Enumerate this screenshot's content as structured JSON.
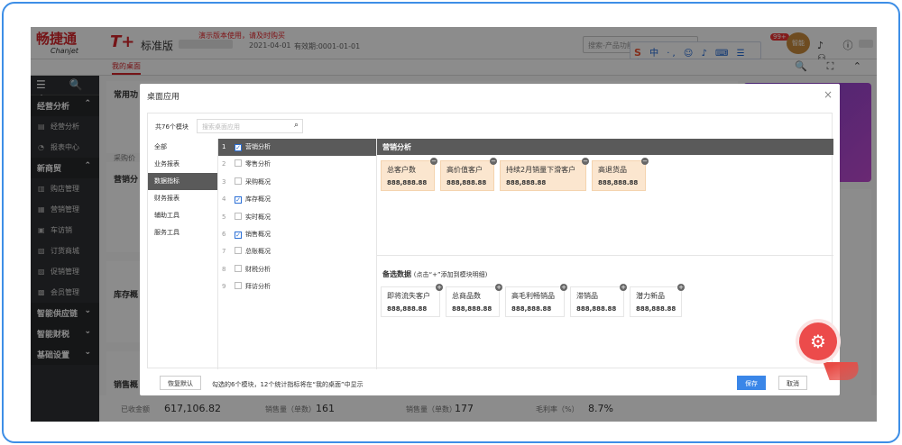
{
  "brand": {
    "name": "畅捷通",
    "sub": "Chanjet",
    "tplus": "T+",
    "edition": "标准版"
  },
  "header": {
    "warning": "演示版本使用，请及时购买",
    "date": "2021-04-01",
    "valid": "有效期:0001-01-01",
    "search_placeholder": "搜索-产品功能",
    "ime": "中 ·, ☺ ♪ ⌨ ☰ ⇧ ⚏",
    "ime_logo": "S",
    "badge": "99+",
    "mascot": "智能",
    "icons": "♪ ⓘ ⚇"
  },
  "tabs": {
    "active": "我的桌面",
    "icons": "🔍 ⛶ ⌃"
  },
  "sidebar": {
    "tools": "☰ 🔍 ＋",
    "groups": [
      {
        "label": "经营分析",
        "arrow": "⌃",
        "items": [
          {
            "icon": "▤",
            "label": "经营分析"
          },
          {
            "icon": "◔",
            "label": "报表中心"
          }
        ]
      },
      {
        "label": "新商贸",
        "arrow": "⌃",
        "items": [
          {
            "icon": "▥",
            "label": "购店管理"
          },
          {
            "icon": "▦",
            "label": "营销管理"
          },
          {
            "icon": "▣",
            "label": "车访销"
          },
          {
            "icon": "▧",
            "label": "订货商城"
          },
          {
            "icon": "▨",
            "label": "促销管理"
          },
          {
            "icon": "▩",
            "label": "会员管理"
          }
        ]
      },
      {
        "label": "智能供应链",
        "arrow": "⌄",
        "items": []
      },
      {
        "label": "智能财税",
        "arrow": "⌄",
        "items": []
      },
      {
        "label": "基础设置",
        "arrow": "⌄",
        "items": []
      }
    ]
  },
  "background": {
    "common": "常用功",
    "marketing": "营销分",
    "inventory": "库存概",
    "sales": "销售概",
    "purchase": "采购价",
    "bottom": {
      "received_label": "已收金额",
      "received_value": "617,106.82",
      "qty_label": "销售量（单数）",
      "qty_value": "161",
      "qty2_label": "销售量（单数）",
      "qty2_value": "177",
      "margin_label": "毛利率（%）",
      "margin_value": "8.7%"
    }
  },
  "modal": {
    "title": "桌面应用",
    "close": "×",
    "count": "共76个模块",
    "search_placeholder": "搜索桌面应用",
    "categories": [
      "全部",
      "业务报表",
      "数据指标",
      "财务报表",
      "辅助工具",
      "服务工具"
    ],
    "active_category": 2,
    "modules": [
      {
        "n": "1",
        "label": "营销分析",
        "checked": true,
        "active": true
      },
      {
        "n": "2",
        "label": "零售分析",
        "checked": false
      },
      {
        "n": "3",
        "label": "采购概况",
        "checked": false
      },
      {
        "n": "4",
        "label": "库存概况",
        "checked": true
      },
      {
        "n": "5",
        "label": "实时概况",
        "checked": false
      },
      {
        "n": "6",
        "label": "销售概况",
        "checked": true
      },
      {
        "n": "7",
        "label": "总账概况",
        "checked": false
      },
      {
        "n": "8",
        "label": "财税分析",
        "checked": false
      },
      {
        "n": "9",
        "label": "拜访分析",
        "checked": false
      }
    ],
    "section1": {
      "title": "营销分析",
      "tiles": [
        {
          "label": "总客户数",
          "value": "888,888.88"
        },
        {
          "label": "高价值客户",
          "value": "888,888.88"
        },
        {
          "label": "持续2月销量下滑客户",
          "value": "888,888.88"
        },
        {
          "label": "高退货品",
          "value": "888,888.88"
        }
      ]
    },
    "section2": {
      "title": "备选数据",
      "hint": "(点击“+”添加到模块明细)",
      "tiles": [
        {
          "label": "即将流失客户",
          "value": "888,888.88"
        },
        {
          "label": "总商品数",
          "value": "888,888.88"
        },
        {
          "label": "高毛利畅销品",
          "value": "888,888.88"
        },
        {
          "label": "滞销品",
          "value": "888,888.88"
        },
        {
          "label": "潜力新品",
          "value": "888,888.88"
        }
      ]
    },
    "reset": "恢复默认",
    "footer_text": "勾选的6个模块，12个统计指标将在“我的桌面”中显示",
    "save": "保存",
    "cancel": "取消"
  },
  "fab_icon": "⚙"
}
